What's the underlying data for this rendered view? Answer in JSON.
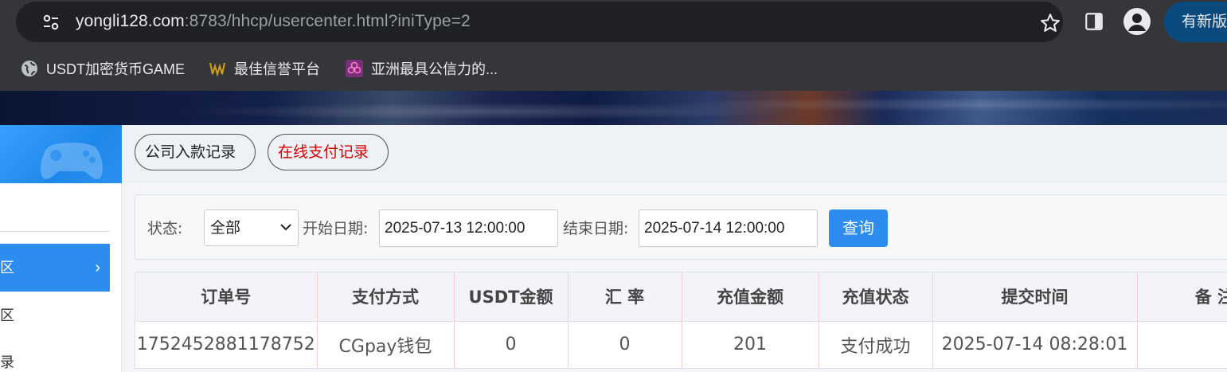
{
  "browser": {
    "url_host": "yongli128.com",
    "url_path": ":8783/hhcp/usercenter.html?iniType=2",
    "update_label": "有新版",
    "bookmarks": [
      {
        "label": "USDT加密货币GAME",
        "icon": "globe-icon"
      },
      {
        "label": "最佳信誉平台",
        "icon": "site-logo-icon"
      },
      {
        "label": "亚洲最具公信力的...",
        "icon": "flower-icon"
      }
    ]
  },
  "sidebar": {
    "items": [
      {
        "label": "区",
        "active": true
      },
      {
        "label": "区",
        "active": false
      },
      {
        "label": "录",
        "active": false
      }
    ]
  },
  "tabs": {
    "company_label": "公司入款记录",
    "online_label": "在线支付记录"
  },
  "filter": {
    "status_label": "状态:",
    "status_value": "全部",
    "start_label": "开始日期:",
    "start_value": "2025-07-13 12:00:00",
    "end_label": "结束日期:",
    "end_value": "2025-07-14 12:00:00",
    "query_label": "查询"
  },
  "table": {
    "headers": [
      "订单号",
      "支付方式",
      "USDT金额",
      "汇 率",
      "充值金额",
      "充值状态",
      "提交时间",
      "备 注"
    ],
    "rows": [
      [
        "1752452881178752",
        "CGpay钱包",
        "0",
        "0",
        "201",
        "支付成功",
        "2025-07-14 08:28:01",
        ""
      ]
    ]
  },
  "colors": {
    "accent": "#2d8cf0",
    "online_tab_text": "#d40000",
    "chrome_bg": "#35363a"
  }
}
